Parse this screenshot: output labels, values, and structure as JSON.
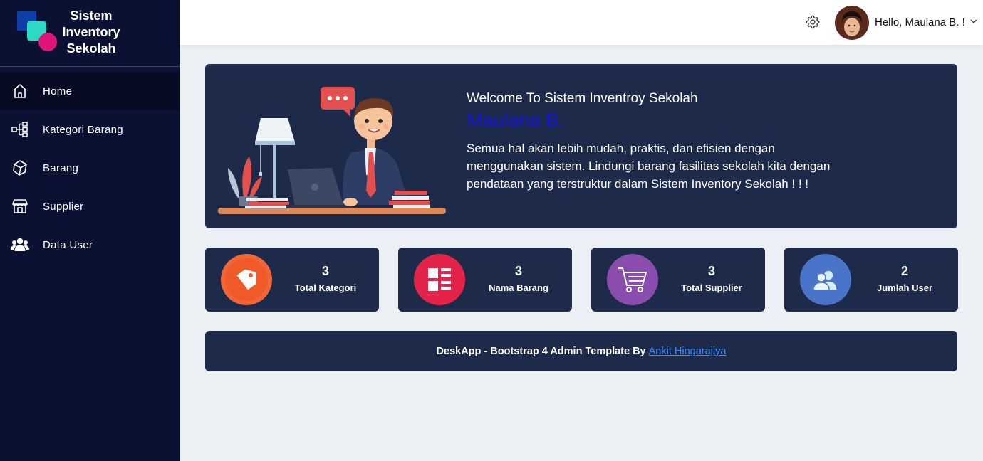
{
  "sidebar": {
    "brand": [
      "Sistem",
      "Inventory",
      "Sekolah"
    ],
    "items": [
      {
        "label": "Home",
        "icon": "home-icon",
        "active": true
      },
      {
        "label": "Kategori Barang",
        "icon": "hierarchy-icon",
        "active": false
      },
      {
        "label": "Barang",
        "icon": "box-icon",
        "active": false
      },
      {
        "label": "Supplier",
        "icon": "store-icon",
        "active": false
      },
      {
        "label": "Data User",
        "icon": "users-icon",
        "active": false
      }
    ]
  },
  "header": {
    "greeting": "Hello, Maulana B. !",
    "settings_icon": "gear-icon",
    "dropdown_icon": "chevron-down-icon"
  },
  "banner": {
    "welcome": "Welcome To Sistem Inventroy Sekolah",
    "user_name": "Maulana B.",
    "description": "Semua hal akan lebih mudah, praktis, dan efisien dengan menggunakan sistem. Lindungi barang fasilitas sekolah kita dengan pendataan yang terstruktur dalam Sistem Inventory Sekolah ! ! !"
  },
  "stats": [
    {
      "value": "3",
      "label": "Total Kategori",
      "icon": "tag-icon",
      "color": "#f05a28"
    },
    {
      "value": "3",
      "label": "Nama Barang",
      "icon": "list-icon",
      "color": "#e4234a"
    },
    {
      "value": "3",
      "label": "Total Supplier",
      "icon": "cart-icon",
      "color": "#8a4dad"
    },
    {
      "value": "2",
      "label": "Jumlah User",
      "icon": "users-icon",
      "color": "#4a74c9"
    }
  ],
  "footer": {
    "text": "DeskApp - Bootstrap 4 Admin Template By",
    "link": "Ankit Hingarajiya"
  },
  "colors": {
    "sidebar_bg": "#0b1133",
    "panel_bg": "#1e2a4a",
    "page_bg": "#ecf0f4",
    "accent_name": "#1a12d8"
  }
}
